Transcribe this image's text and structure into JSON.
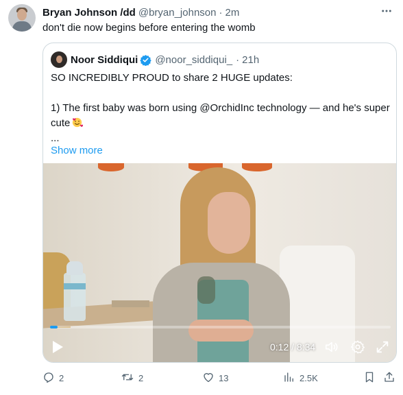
{
  "tweet": {
    "author_name": "Bryan Johnson /dd",
    "author_handle": "@bryan_johnson",
    "separator": "·",
    "time": "2m",
    "text": "don't die now begins before entering the womb"
  },
  "quote": {
    "author_name": "Noor Siddiqui",
    "author_handle": "@noor_siddiqui_",
    "separator": "·",
    "time": "21h",
    "line1": "SO INCREDIBLY PROUD to share 2 HUGE updates:",
    "line2": "1) The first baby was born using @OrchidInc technology — and he's super cute",
    "ellipsis": "...",
    "show_more": "Show more",
    "verified_icon": "verified-badge-icon",
    "emoji_icon": "smiling-face-with-hearts-icon"
  },
  "video": {
    "time_display": "0:12 / 8:34",
    "progress": 0.023,
    "accent": "#1d9bf0"
  },
  "actions": {
    "replies": "2",
    "reposts": "2",
    "likes": "13",
    "views": "2.5K"
  },
  "colors": {
    "text": "#0f1419",
    "secondary": "#536471",
    "link": "#1d9bf0",
    "border": "#cfd9de"
  }
}
